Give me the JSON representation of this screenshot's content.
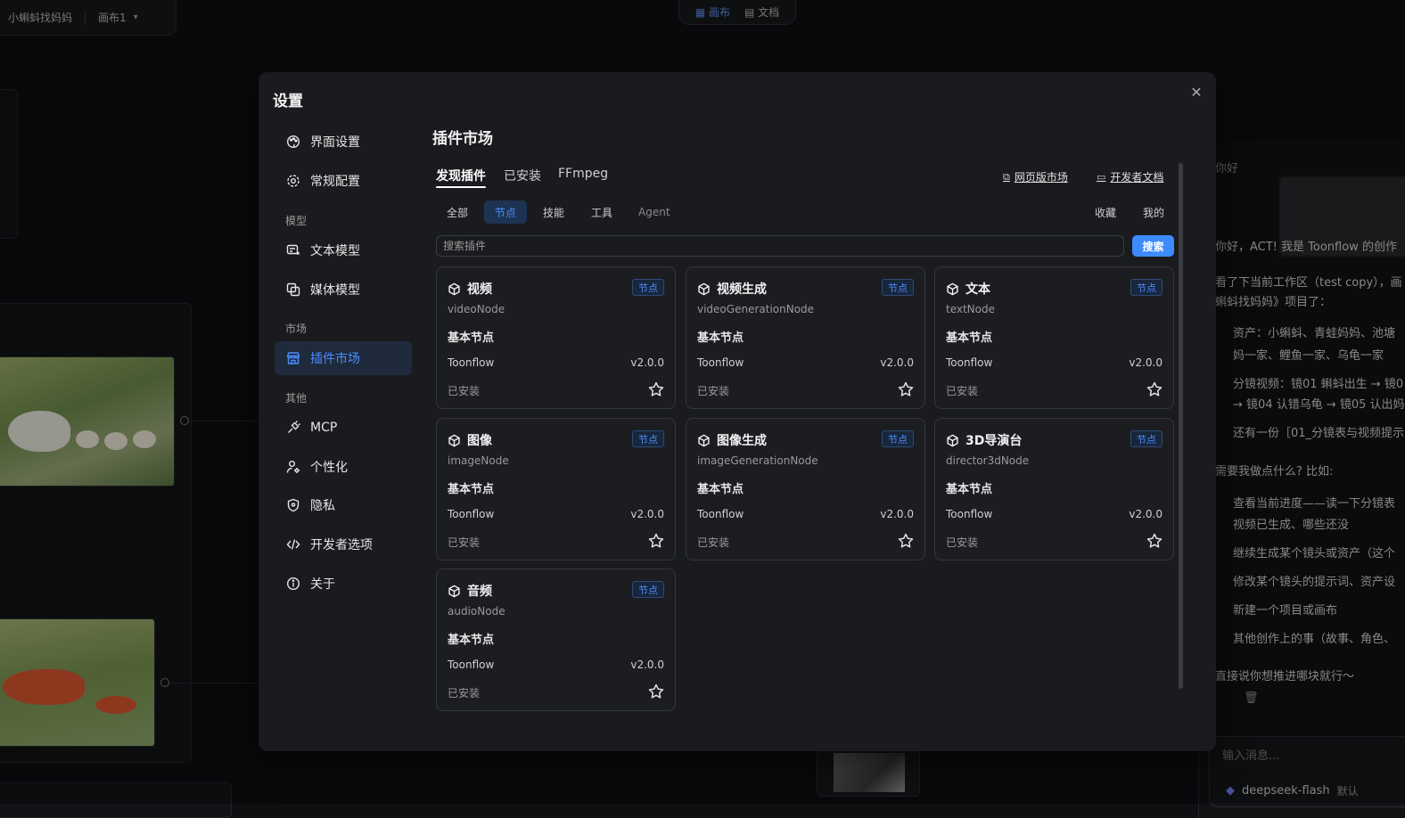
{
  "app": {
    "project_name": "小蝌蚪找妈妈",
    "canvas_selector": "画布1",
    "view_tabs": [
      {
        "label": "画布",
        "active": true
      },
      {
        "label": "文档",
        "active": false
      }
    ]
  },
  "chat": {
    "lines": [
      "你好",
      "你好，ACT! 我是 Toonflow 的创作",
      "看了下当前工作区（test copy），画",
      "蝌蚪找妈妈》项目了：",
      "资产：小蝌蚪、青蛙妈妈、池塘",
      "妈一家、鲤鱼一家、乌龟一家",
      "分镜视频：镜01 蝌蚪出生 → 镜0",
      "→ 镜04 认错乌龟 → 镜05 认出妈",
      "还有一份［01_分镜表与视频提示",
      "需要我做点什么? 比如:",
      "查看当前进度——读一下分镜表",
      "视频已生成、哪些还没",
      "继续生成某个镜头或资产（这个",
      "修改某个镜头的提示词、资产设",
      "新建一个项目或画布",
      "其他创作上的事（故事、角色、",
      "直接说你想推进哪块就行～"
    ],
    "input_placeholder": "输入消息...",
    "model": "deepseek-flash",
    "model_mode": "默认"
  },
  "dialog": {
    "title": "设置",
    "sidebar": {
      "items_top": [
        {
          "label": "界面设置",
          "icon": "palette-icon"
        },
        {
          "label": "常规配置",
          "icon": "gear-icon"
        }
      ],
      "group_model": "模型",
      "items_model": [
        {
          "label": "文本模型",
          "icon": "text-model-icon"
        },
        {
          "label": "媒体模型",
          "icon": "media-model-icon"
        }
      ],
      "group_market": "市场",
      "items_market": [
        {
          "label": "插件市场",
          "icon": "store-icon",
          "active": true
        }
      ],
      "group_other": "其他",
      "items_other": [
        {
          "label": "MCP",
          "icon": "plug-icon"
        },
        {
          "label": "个性化",
          "icon": "user-settings-icon"
        },
        {
          "label": "隐私",
          "icon": "shield-icon"
        },
        {
          "label": "开发者选项",
          "icon": "code-icon"
        },
        {
          "label": "关于",
          "icon": "info-icon"
        }
      ]
    },
    "content": {
      "title": "插件市场",
      "tabs": [
        {
          "label": "发现插件",
          "active": true
        },
        {
          "label": "已安装",
          "active": false
        },
        {
          "label": "FFmpeg",
          "active": false
        }
      ],
      "links": {
        "web_market": "网页版市场",
        "dev_docs": "开发者文档"
      },
      "filters": [
        {
          "label": "全部",
          "active": false
        },
        {
          "label": "节点",
          "active": true
        },
        {
          "label": "技能",
          "active": false
        },
        {
          "label": "工具",
          "active": false
        },
        {
          "label": "Agent",
          "active": false
        }
      ],
      "filters_right": [
        "收藏",
        "我的"
      ],
      "search": {
        "placeholder": "搜索插件",
        "button": "搜索"
      },
      "plugins": [
        {
          "name": "视频",
          "node": "videoNode",
          "badge": "节点",
          "category": "基本节点",
          "author": "Toonflow",
          "version": "v2.0.0",
          "status": "已安装"
        },
        {
          "name": "视频生成",
          "node": "videoGenerationNode",
          "badge": "节点",
          "category": "基本节点",
          "author": "Toonflow",
          "version": "v2.0.0",
          "status": "已安装"
        },
        {
          "name": "文本",
          "node": "textNode",
          "badge": "节点",
          "category": "基本节点",
          "author": "Toonflow",
          "version": "v2.0.0",
          "status": "已安装"
        },
        {
          "name": "图像",
          "node": "imageNode",
          "badge": "节点",
          "category": "基本节点",
          "author": "Toonflow",
          "version": "v2.0.0",
          "status": "已安装"
        },
        {
          "name": "图像生成",
          "node": "imageGenerationNode",
          "badge": "节点",
          "category": "基本节点",
          "author": "Toonflow",
          "version": "v2.0.0",
          "status": "已安装"
        },
        {
          "name": "3D导演台",
          "node": "director3dNode",
          "badge": "节点",
          "category": "基本节点",
          "author": "Toonflow",
          "version": "v2.0.0",
          "status": "已安装"
        },
        {
          "name": "音频",
          "node": "audioNode",
          "badge": "节点",
          "category": "基本节点",
          "author": "Toonflow",
          "version": "v2.0.0",
          "status": "已安装"
        }
      ]
    }
  },
  "colors": {
    "accent": "#3d8bfd",
    "accent_text": "#4c8dff",
    "dialog_bg": "#1a1b1e",
    "card_border": "#33363c"
  }
}
